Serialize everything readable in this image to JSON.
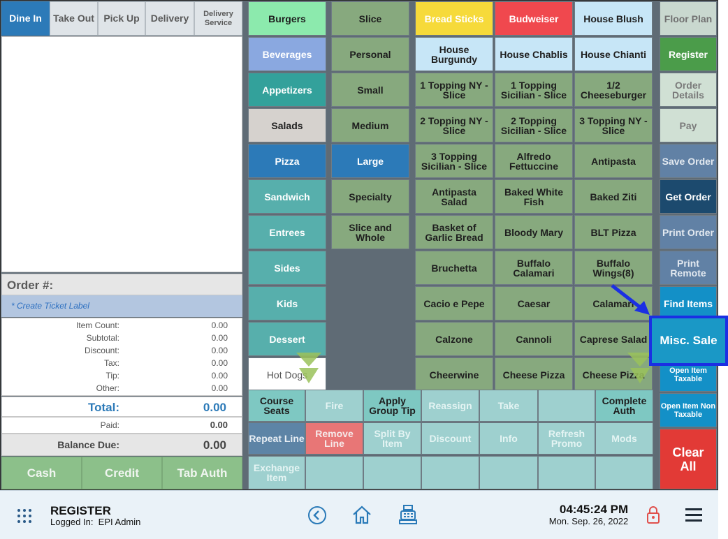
{
  "order_types": [
    "Dine In",
    "Take Out",
    "Pick Up",
    "Delivery",
    "Delivery Service"
  ],
  "order_panel": {
    "order_label": "Order #:",
    "ticket_label": "* Create Ticket Label",
    "item_count_label": "Item Count:",
    "item_count": "0.00",
    "subtotal_label": "Subtotal:",
    "subtotal": "0.00",
    "discount_label": "Discount:",
    "discount": "0.00",
    "tax_label": "Tax:",
    "tax": "0.00",
    "tip_label": "Tip:",
    "tip": "0.00",
    "other_label": "Other:",
    "other": "0.00",
    "total_label": "Total:",
    "total": "0.00",
    "paid_label": "Paid:",
    "paid": "0.00",
    "balance_label": "Balance Due:",
    "balance": "0.00"
  },
  "payment_buttons": [
    "Cash",
    "Credit",
    "Tab Auth"
  ],
  "categories": [
    "Burgers",
    "Beverages",
    "Appetizers",
    "Salads",
    "Pizza",
    "Sandwich",
    "Entrees",
    "Sides",
    "Kids",
    "Dessert",
    "Hot Dogs"
  ],
  "sizes": [
    "Slice",
    "Personal",
    "Small",
    "Medium",
    "Large",
    "Specialty",
    "Slice and Whole"
  ],
  "items": [
    [
      "Bread Sticks",
      "Budweiser",
      "House Blush"
    ],
    [
      "House Burgundy",
      "House Chablis",
      "House Chianti"
    ],
    [
      "1 Topping NY - Slice",
      "1 Topping Sicilian - Slice",
      "1/2 Cheeseburger"
    ],
    [
      "2 Topping NY - Slice",
      "2 Topping Sicilian -  Slice",
      "3 Topping NY - Slice"
    ],
    [
      "3 Topping Sicilian - Slice",
      "Alfredo Fettuccine",
      "Antipasta"
    ],
    [
      "Antipasta Salad",
      "Baked White Fish",
      "Baked Ziti"
    ],
    [
      "Basket of Garlic Bread",
      "Bloody Mary",
      "BLT Pizza"
    ],
    [
      "Bruchetta",
      "Buffalo Calamari",
      "Buffalo Wings(8)"
    ],
    [
      "Cacio e Pepe",
      "Caesar",
      "Calamari"
    ],
    [
      "Calzone",
      "Cannoli",
      "Caprese Salad"
    ],
    [
      "Cheerwine",
      "Cheese Pizza",
      "Cheese Pizza"
    ]
  ],
  "right_buttons": {
    "floor_plan": "Floor Plan",
    "register": "Register",
    "order_details": "Order Details",
    "pay": "Pay",
    "save_order": "Save Order",
    "get_order": "Get Order",
    "print_order": "Print Order",
    "print_remote": "Print Remote",
    "find_items": "Find Items",
    "misc_sale": "Misc. Sale",
    "open_item_taxable": "Open Item Taxable",
    "open_item_non_taxable": "Open Item Non Taxable",
    "clear_all": "Clear All"
  },
  "actions_row1": [
    "Course Seats",
    "Fire",
    "Apply Group Tip",
    "Reassign",
    "Take",
    "",
    "Complete Auth"
  ],
  "actions_row2": [
    "Repeat Line",
    "Remove Line",
    "Split By Item",
    "Discount",
    "Info",
    "Refresh Promo",
    "Mods"
  ],
  "actions_row3": [
    "Exchange Item",
    "",
    "",
    "",
    "",
    "",
    ""
  ],
  "footer": {
    "title": "REGISTER",
    "logged_in": "Logged In:  EPI Admin",
    "time": "04:45:24 PM",
    "date": "Mon. Sep. 26, 2022"
  },
  "icons": [
    "grid-menu-icon",
    "back-icon",
    "home-icon",
    "cash-register-icon",
    "lock-icon",
    "hamburger-menu-icon"
  ]
}
